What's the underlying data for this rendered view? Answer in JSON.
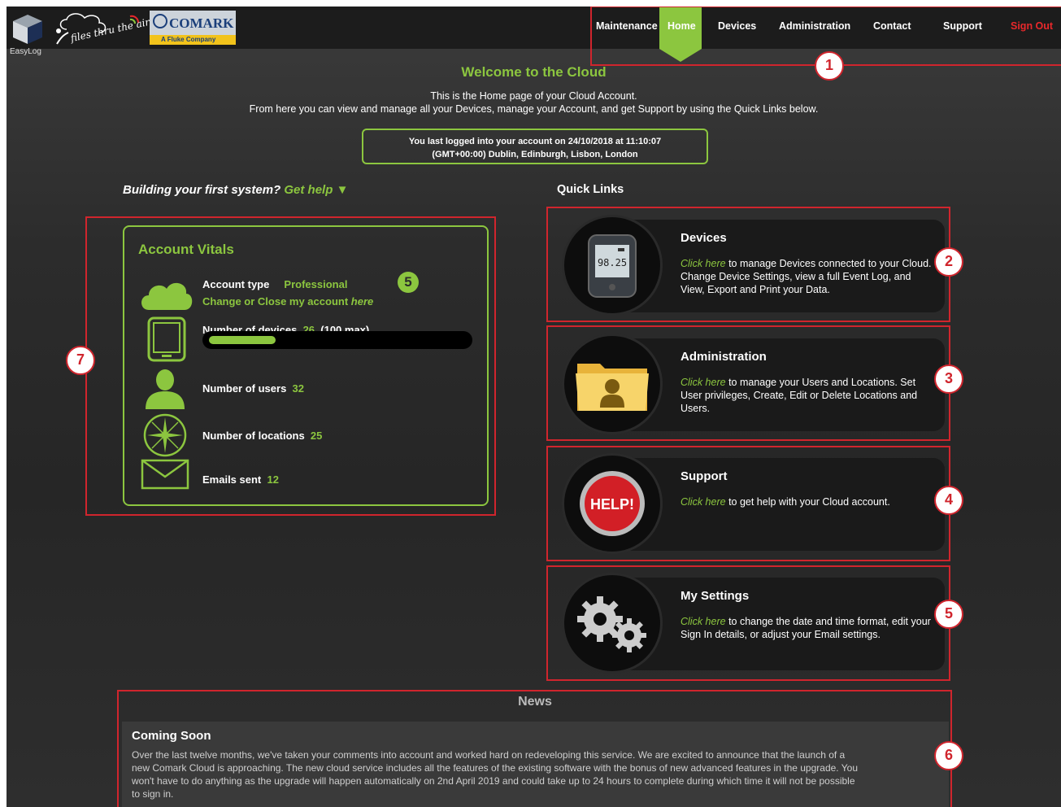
{
  "header": {
    "easylog_label": "EasyLog",
    "files_logo_text": "files thru the air",
    "comark_name": "COMARK",
    "comark_sub": "A Fluke Company"
  },
  "nav": {
    "items": [
      "Maintenance",
      "Home",
      "Devices",
      "Administration",
      "Contact",
      "Support",
      "Sign Out"
    ],
    "active": "Home"
  },
  "welcome": {
    "title": "Welcome to the Cloud",
    "intro_line1": "This is the Home page of your Cloud Account.",
    "intro_line2": "From here you can view and manage all your Devices, manage your Account, and get Support by using the Quick Links below.",
    "last_login_line1": "You last logged into your account on 24/10/2018 at 11:10:07",
    "last_login_line2": "(GMT+00:00) Dublin, Edinburgh, Lisbon, London"
  },
  "building": {
    "prefix": "Building your first system?",
    "link": "Get help",
    "arrow": "▼"
  },
  "quick_links_title": "Quick Links",
  "vitals": {
    "title": "Account Vitals",
    "account_type_label": "Account type",
    "account_type_value": "Professional",
    "change_close_prefix": "Change or Close my account",
    "change_close_link": "here",
    "devices_label": "Number of devices",
    "devices_value": "26",
    "devices_max": "(100 max)",
    "devices_fraction": 0.26,
    "users_label": "Number of users",
    "users_value": "32",
    "locations_label": "Number of locations",
    "locations_value": "25",
    "emails_label": "Emails sent",
    "emails_value": "12",
    "badge": "5"
  },
  "cards": [
    {
      "title": "Devices",
      "link": "Click here",
      "desc": "to manage Devices connected to your Cloud. Change Device Settings, view a full Event Log, and View, Export and Print your Data.",
      "icon": "data-logger-icon",
      "display": "98.25"
    },
    {
      "title": "Administration",
      "link": "Click here",
      "desc": "to manage your Users and Locations. Set User privileges, Create, Edit or Delete Locations and Users.",
      "icon": "user-folder-icon"
    },
    {
      "title": "Support",
      "link": "Click here",
      "desc": "to get help with your Cloud account.",
      "icon": "help-button-icon",
      "icon_text": "HELP!"
    },
    {
      "title": "My Settings",
      "link": "Click here",
      "desc": "to change the date and time format, edit your Sign In details, or adjust your Email settings.",
      "icon": "gears-icon"
    }
  ],
  "news": {
    "title": "News",
    "heading": "Coming Soon",
    "body": "Over the last twelve months, we've taken your comments into account and worked hard on redeveloping this service. We are excited to announce that the launch of a new Comark Cloud is approaching. The new cloud service includes all the features of the existing software with the bonus of new advanced features in the upgrade. You won't have to do anything as the upgrade will happen automatically on 2nd April 2019 and could take up to 24 hours to complete during which time it will not be possible to sign in."
  },
  "callouts": [
    "1",
    "2",
    "3",
    "4",
    "5",
    "6",
    "7"
  ],
  "colors": {
    "accent": "#8cc63f",
    "sign_out": "#e8282b",
    "callout": "#d0252d"
  }
}
